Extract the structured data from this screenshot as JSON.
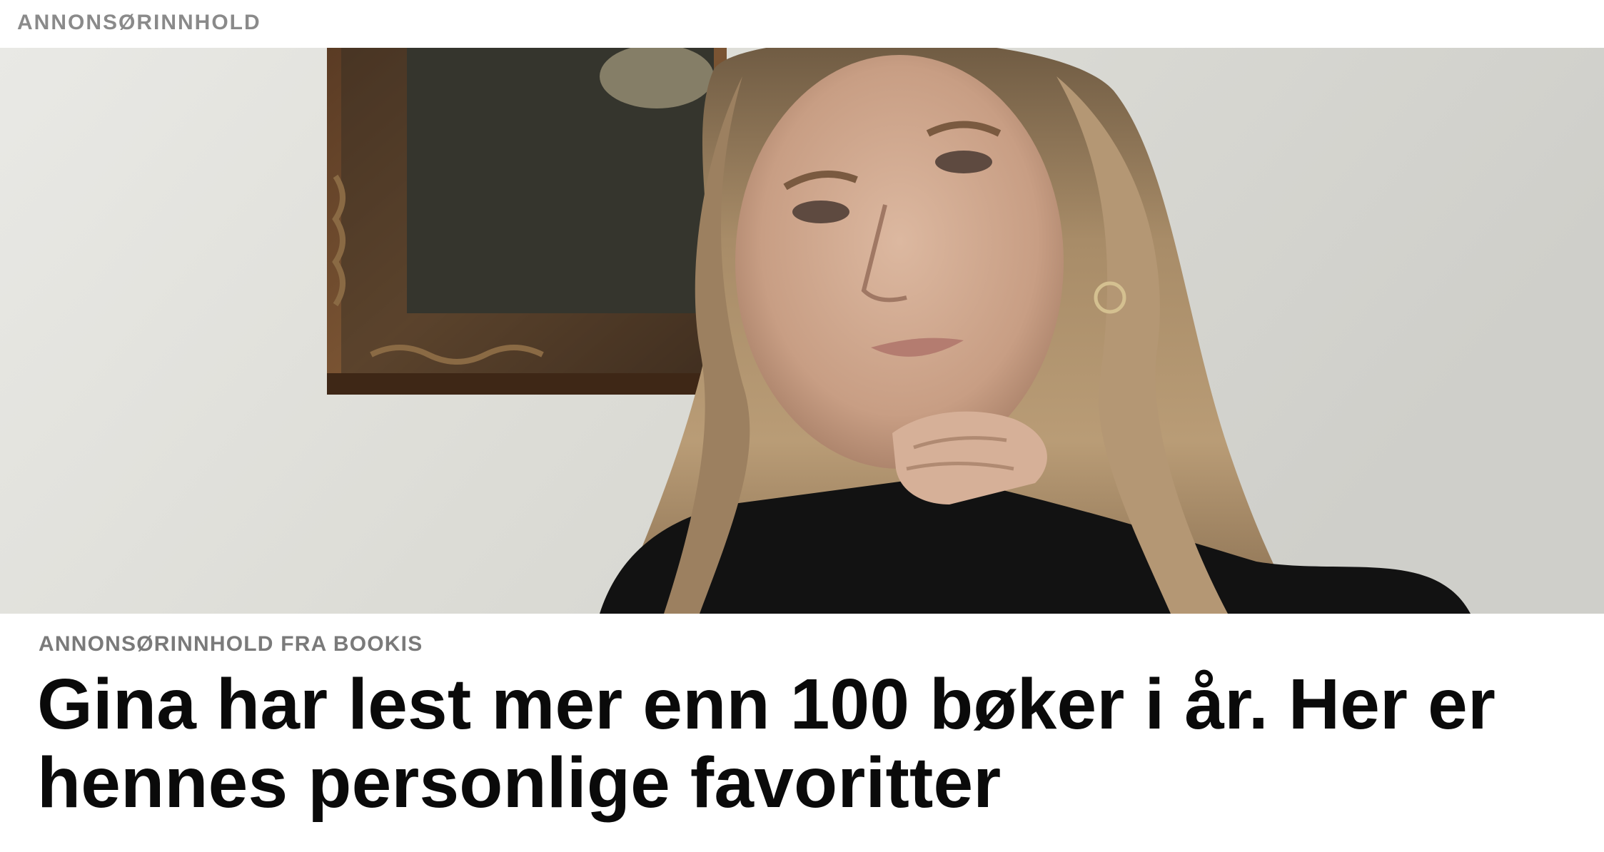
{
  "header": {
    "label": "ANNONSØRINNHOLD"
  },
  "hero": {
    "alt": "Portrait of a woman with long blonde hair resting her chin on her hand, framed painting in background"
  },
  "article": {
    "sponsor_label": "ANNONSØRINNHOLD FRA BOOKIS",
    "headline": "Gina har lest mer enn 100 bøker i år. Her er hennes personlige favoritter"
  }
}
